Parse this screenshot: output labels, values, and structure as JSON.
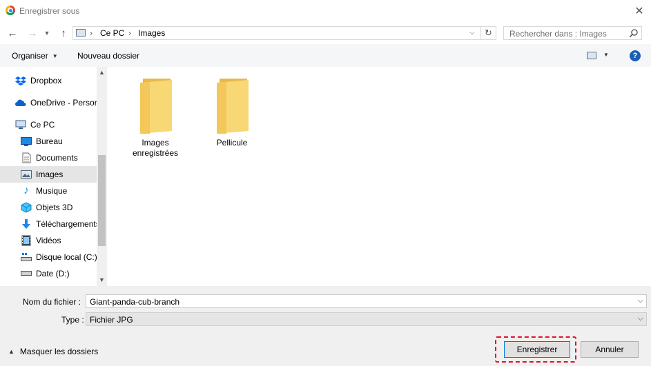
{
  "window": {
    "title": "Enregistrer sous"
  },
  "address": {
    "crumbs": [
      "Ce PC",
      "Images"
    ]
  },
  "search": {
    "placeholder": "Rechercher dans : Images"
  },
  "toolbar": {
    "organize": "Organiser",
    "new_folder": "Nouveau dossier"
  },
  "nav": {
    "items": [
      {
        "label": "Dropbox",
        "icon": "dropbox-icon"
      },
      {
        "label": "OneDrive - Persor",
        "icon": "onedrive-icon"
      },
      {
        "label": "Ce PC",
        "icon": "computer-icon"
      },
      {
        "label": "Bureau",
        "icon": "desktop-icon"
      },
      {
        "label": "Documents",
        "icon": "documents-icon"
      },
      {
        "label": "Images",
        "icon": "images-icon",
        "selected": true
      },
      {
        "label": "Musique",
        "icon": "music-icon"
      },
      {
        "label": "Objets 3D",
        "icon": "3d-objects-icon"
      },
      {
        "label": "Téléchargements",
        "icon": "downloads-icon"
      },
      {
        "label": "Vidéos",
        "icon": "videos-icon"
      },
      {
        "label": "Disque local (C:)",
        "icon": "drive-icon"
      },
      {
        "label": "Date (D:)",
        "icon": "drive-icon"
      }
    ]
  },
  "folders": [
    {
      "label_line1": "Images",
      "label_line2": "enregistrées"
    },
    {
      "label_line1": "Pellicule",
      "label_line2": ""
    }
  ],
  "form": {
    "filename_label": "Nom du fichier :",
    "filename_value": "Giant-panda-cub-branch",
    "type_label": "Type :",
    "type_value": "Fichier JPG"
  },
  "footer": {
    "hide_folders": "Masquer les dossiers",
    "save": "Enregistrer",
    "cancel": "Annuler"
  },
  "colors": {
    "highlight": "#e0112b",
    "selection": "#e5e5e5",
    "folder": "#f8d775"
  }
}
